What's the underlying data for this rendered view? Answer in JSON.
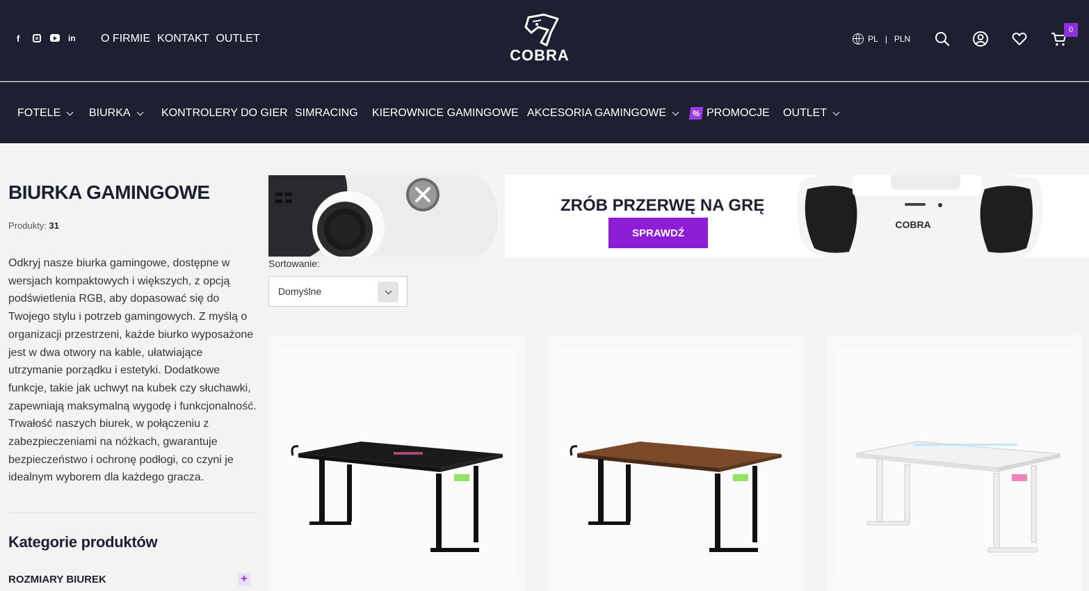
{
  "header": {
    "social": [
      "facebook-icon",
      "instagram-icon",
      "youtube-icon",
      "linkedin-icon"
    ],
    "top_links": [
      "O FIRMIE",
      "KONTAKT",
      "OUTLET"
    ],
    "logo_text": "COBRA",
    "lang": "PL",
    "currency": "PLN",
    "cart_count": "0"
  },
  "nav": {
    "items": [
      {
        "label": "FOTELE",
        "dropdown": true
      },
      {
        "label": "BIURKA",
        "dropdown": true
      },
      {
        "label": "KONTROLERY DO GIER",
        "dropdown": false
      },
      {
        "label": "SIMRACING",
        "dropdown": false
      },
      {
        "label": "KIEROWNICE GAMINGOWE",
        "dropdown": false
      },
      {
        "label": "AKCESORIA GAMINGOWE",
        "dropdown": true
      },
      {
        "label": "PROMOCJE",
        "dropdown": false,
        "icon": "percent-icon"
      },
      {
        "label": "OUTLET",
        "dropdown": true
      }
    ]
  },
  "sidebar": {
    "title": "BIURKA GAMINGOWE",
    "count_label": "Produkty:",
    "count_value": "31",
    "description": "Odkryj nasze biurka gamingowe, dostępne w wersjach kompaktowych i większych, z opcją podświetlenia RGB, aby dopasować się do Twojego stylu i potrzeb gamingowych. Z myślą o organizacji przestrzeni, każde biurko wyposażone jest w dwa otwory na kable, ułatwiające utrzymanie porządku i estetyki. Dodatkowe funkcje, takie jak uchwyt na kubek czy słuchawki, zapewniają maksymalną wygodę i funkcjonalność. Trwałość naszych biurek, w połączeniu z zabezpieczeniami na nóżkach, gwarantuje bezpieczeństwo i ochronę podłogi, co czyni je idealnym wyborem dla każdego gracza.",
    "categories_title": "Kategorie produktów",
    "categories": [
      {
        "label": "ROZMIARY BIUREK"
      }
    ]
  },
  "banner": {
    "headline": "ZRÓB PRZERWĘ NA GRĘ",
    "button": "SPRAWDŹ",
    "controller_logo": "COBRA"
  },
  "sort": {
    "label": "Sortowanie:",
    "value": "Domyślne"
  },
  "products": [
    {
      "name": "desk-black",
      "top_color": "#1a1a1a",
      "leg_color": "#1a1a1a"
    },
    {
      "name": "desk-walnut",
      "top_color": "#7a4a2a",
      "leg_color": "#1a1a1a"
    },
    {
      "name": "desk-white",
      "top_color": "#f0f0f0",
      "leg_color": "#f4f4f4"
    }
  ],
  "colors": {
    "dark": "#1d2030",
    "accent": "#8e1ed6"
  }
}
